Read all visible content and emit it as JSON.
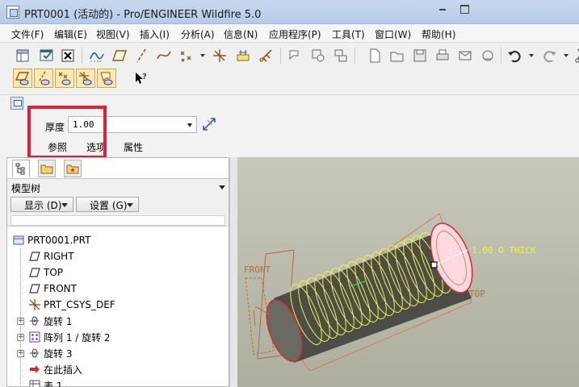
{
  "window": {
    "title": "PRT0001 (活动的) - Pro/ENGINEER Wildfire 5.0"
  },
  "menu": [
    "文件(F)",
    "编辑(E)",
    "视图(V)",
    "插入(I)",
    "分析(A)",
    "信息(N)",
    "应用程序(P)",
    "工具(T)",
    "窗口(W)",
    "帮助(H)"
  ],
  "dashboard": {
    "thickness_label": "厚度",
    "thickness_value": "1.00",
    "tabs": [
      "参照",
      "选项",
      "属性"
    ]
  },
  "model_tree": {
    "title": "模型树",
    "show_button": "显示 (D)",
    "settings_button": "设置 (G)",
    "items": [
      {
        "label": "PRT0001.PRT",
        "icon": "part-icon"
      },
      {
        "label": "RIGHT",
        "icon": "datum-plane-icon"
      },
      {
        "label": "TOP",
        "icon": "datum-plane-icon"
      },
      {
        "label": "FRONT",
        "icon": "datum-plane-icon"
      },
      {
        "label": "PRT_CSYS_DEF",
        "icon": "coordinate-system-icon"
      },
      {
        "label": "旋转 1",
        "icon": "revolve-icon"
      },
      {
        "label": "阵列 1 / 旋转 2",
        "icon": "pattern-icon"
      },
      {
        "label": "旋转 3",
        "icon": "revolve-icon"
      },
      {
        "label": "在此插入",
        "icon": "insert-here-icon"
      },
      {
        "label": "表 1",
        "icon": "table-icon"
      }
    ]
  },
  "viewport": {
    "label_front": "FRONT",
    "label_thick": "1.00 O_THICK",
    "label_top": "TOP"
  },
  "colors": {
    "selection_red": "#e0203a",
    "highlight_yellow": "#f2f24a",
    "preview_orange": "#c8782e"
  }
}
